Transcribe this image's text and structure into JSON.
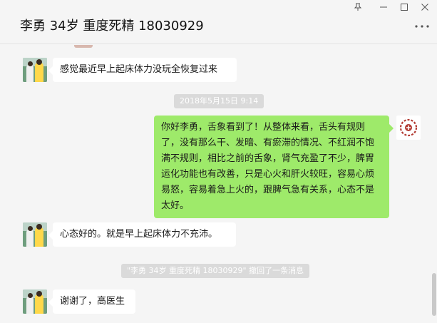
{
  "window": {
    "title": "李勇 34岁 重度死精 18030929",
    "pin_icon": "pin-icon",
    "minimize_icon": "minimize-icon",
    "maximize_icon": "maximize-icon",
    "close_icon": "close-icon",
    "more_icon": "more-icon"
  },
  "messages": [
    {
      "side": "left",
      "text": "感觉最近早上起床体力没玩全恢复过来"
    },
    {
      "side": "right",
      "text": "你好李勇，舌象看到了！从整体来看，舌头有规则了，没有那么干、发暗、有瘀滞的情况、不红润不饱满不规则，相比之前的舌象，肾气充盈了不少，脾胃运化功能也有改善，只是心火和肝火较旺，容易心烦易怒，容易着急上火的，跟脾气急有关系，心态不是太好。"
    },
    {
      "side": "left",
      "text": "心态好的。就是早上起床体力不充沛。"
    },
    {
      "side": "left",
      "text": "谢谢了，高医生"
    }
  ],
  "timestamp": "2018年5月15日 9:14",
  "recall_notice": "\"李勇 34岁 重度死精 18030929\" 撤回了一条消息",
  "colors": {
    "own_bubble": "#9eea6a",
    "other_bubble": "#ffffff",
    "background": "#f5f5f5"
  }
}
